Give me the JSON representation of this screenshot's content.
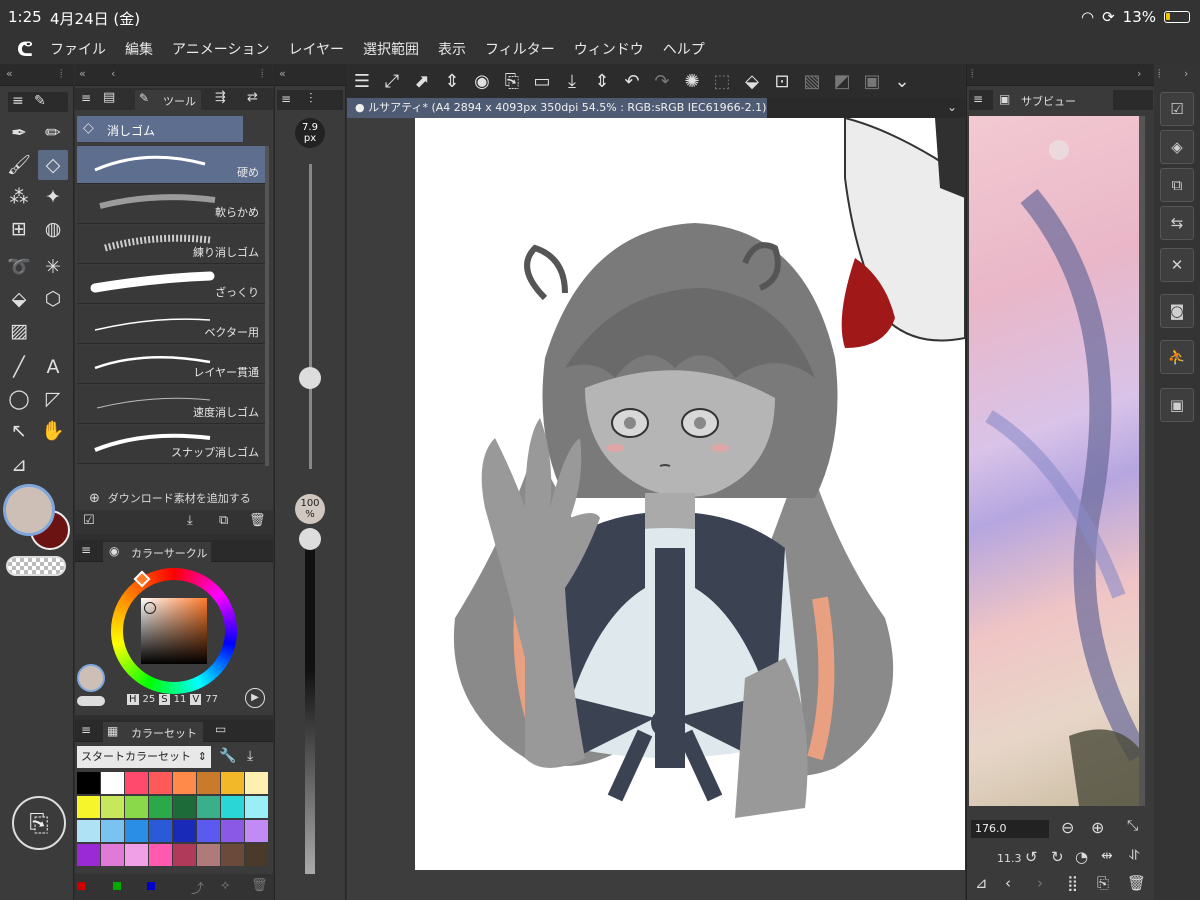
{
  "status": {
    "time": "1:25",
    "date": "4月24日 (金)",
    "battery": "13%"
  },
  "menu": {
    "items": [
      "ファイル",
      "編集",
      "アニメーション",
      "レイヤー",
      "選択範囲",
      "表示",
      "フィルター",
      "ウィンドウ",
      "ヘルプ"
    ]
  },
  "subtool": {
    "tab_label": "ツール",
    "group_label": "消しゴム",
    "brushes": [
      "硬め",
      "軟らかめ",
      "練り消しゴム",
      "ざっくり",
      "ベクター用",
      "レイヤー貫通",
      "速度消しゴム",
      "スナップ消しゴム"
    ],
    "download_label": "ダウンロード素材を追加する"
  },
  "brush_size": {
    "size_value": "7.9",
    "size_unit": "px",
    "opacity_value": "100",
    "opacity_unit": "%",
    "size_level": 0.3,
    "opacity_level": 1.0
  },
  "canvas": {
    "title": "ルサアティ* (A4 2894 x 4093px 350dpi 54.5% : RGB:sRGB IEC61966-2.1)"
  },
  "subview": {
    "tab_label": "サブビュー",
    "zoom_value": "176.0",
    "rotate_value": "11.3"
  },
  "color_circle": {
    "tab_label": "カラーサークル",
    "h_label": "H",
    "h_value": "25",
    "s_label": "S",
    "s_value": "11",
    "v_label": "V",
    "v_value": "77"
  },
  "color_set": {
    "tab_label": "カラーセット",
    "set_name": "スタートカラーセット",
    "swatches": [
      "#000000",
      "#ffffff",
      "#ff4a6e",
      "#ff5959",
      "#ff8a4a",
      "#c97a2a",
      "#f2b82a",
      "#fff0b0",
      "#f5f52a",
      "#c7e85a",
      "#8ad94a",
      "#2aa84a",
      "#1e6b3a",
      "#3ab08a",
      "#2ad6d6",
      "#9aeef5",
      "#b0e2f5",
      "#7ac2f0",
      "#2a8ee6",
      "#2a5ad6",
      "#1a2ab8",
      "#5a5af0",
      "#8a5ae6",
      "#c28af5",
      "#9a2ad6",
      "#e07ad6",
      "#f0a0e6",
      "#ff5ab0",
      "#b03a5a",
      "#b07a7a",
      "#6a4a3a",
      "#4a3a2a"
    ]
  },
  "colors": {
    "main_color": "#cdbfb6",
    "sub_color": "#6b1212",
    "accent": "#5b6a85"
  }
}
